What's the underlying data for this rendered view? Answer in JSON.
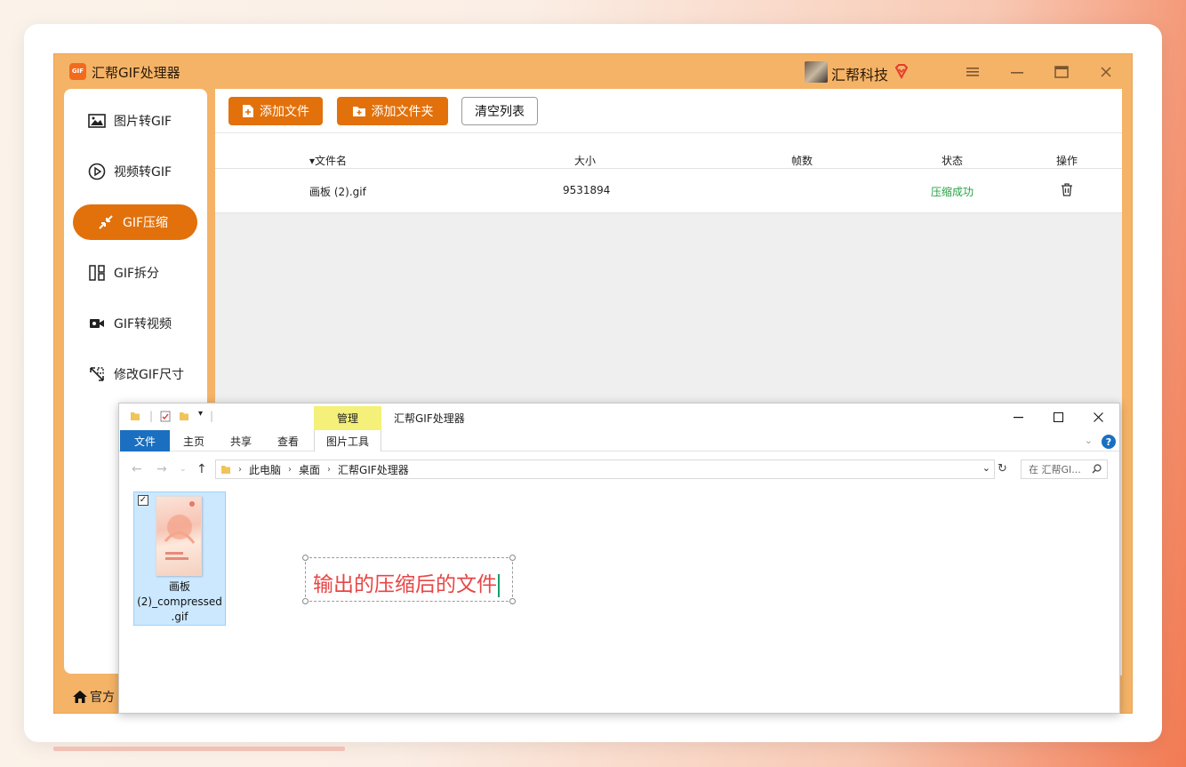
{
  "app": {
    "title": "汇帮GIF处理器",
    "logo_text": "GIF",
    "user_name": "汇帮科技",
    "accent": "#e2710b",
    "window_controls": [
      "menu-icon",
      "minimize-icon",
      "maximize-icon",
      "close-icon"
    ]
  },
  "sidebar": {
    "items": [
      {
        "label": "图片转GIF",
        "icon": "image-icon"
      },
      {
        "label": "视频转GIF",
        "icon": "play-circle-icon"
      },
      {
        "label": "GIF压缩",
        "icon": "compress-icon",
        "active": true
      },
      {
        "label": "GIF拆分",
        "icon": "split-icon"
      },
      {
        "label": "GIF转视频",
        "icon": "video-camera-icon"
      },
      {
        "label": "修改GIF尺寸",
        "icon": "resize-icon"
      }
    ],
    "home_label": "官方"
  },
  "toolbar": {
    "add_file": "添加文件",
    "add_folder": "添加文件夹",
    "clear_list": "清空列表"
  },
  "table": {
    "headers": {
      "name": "文件名",
      "size": "大小",
      "frames": "帧数",
      "status": "状态",
      "action": "操作"
    },
    "rows": [
      {
        "name": "画板 (2).gif",
        "size": "9531894",
        "frames": "",
        "status": "压缩成功",
        "action_icon": "trash-icon"
      }
    ]
  },
  "explorer": {
    "title": "汇帮GIF处理器",
    "manage_tab": "管理",
    "ribbon_tabs": [
      "文件",
      "主页",
      "共享",
      "查看",
      "图片工具"
    ],
    "breadcrumb": [
      "此电脑",
      "桌面",
      "汇帮GIF处理器"
    ],
    "search_placeholder": "在 汇帮GI...",
    "file": {
      "name_line1": "画板",
      "name_line2": "(2)_compressed",
      "name_line3": ".gif"
    },
    "annotation": "输出的压缩后的文件"
  }
}
